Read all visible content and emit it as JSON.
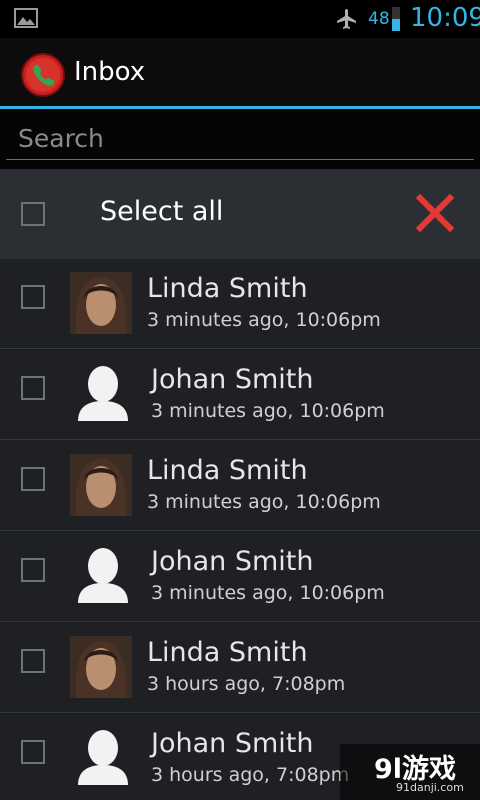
{
  "status_bar": {
    "battery_level": "48",
    "battery_fraction": 0.48,
    "time": "10:09",
    "accent_color": "#33b5e5",
    "icons": [
      "image-icon",
      "airplane-icon",
      "battery-icon"
    ]
  },
  "action_bar": {
    "title": "Inbox",
    "app_icon": "call-recorder-icon"
  },
  "search": {
    "placeholder": "Search",
    "value": ""
  },
  "select_all": {
    "label": "Select all",
    "checked": false,
    "clear_icon": "close-icon",
    "clear_color": "#e53935"
  },
  "items": [
    {
      "name": "Linda Smith",
      "time": "3 minutes ago, 10:06pm",
      "avatar": "photo-avatar",
      "checked": false
    },
    {
      "name": "Johan Smith",
      "time": "3 minutes ago, 10:06pm",
      "avatar": "default-contact-avatar",
      "checked": false
    },
    {
      "name": "Linda Smith",
      "time": "3 minutes ago, 10:06pm",
      "avatar": "photo-avatar",
      "checked": false
    },
    {
      "name": "Johan Smith",
      "time": "3 minutes ago, 10:06pm",
      "avatar": "default-contact-avatar",
      "checked": false
    },
    {
      "name": "Linda Smith",
      "time": "3 hours ago, 7:08pm",
      "avatar": "photo-avatar",
      "checked": false
    },
    {
      "name": "Johan Smith",
      "time": "3 hours ago, 7:08pm",
      "avatar": "default-contact-avatar",
      "checked": false
    }
  ],
  "watermark": {
    "main": "9l游戏",
    "sub": "91danji.com"
  }
}
